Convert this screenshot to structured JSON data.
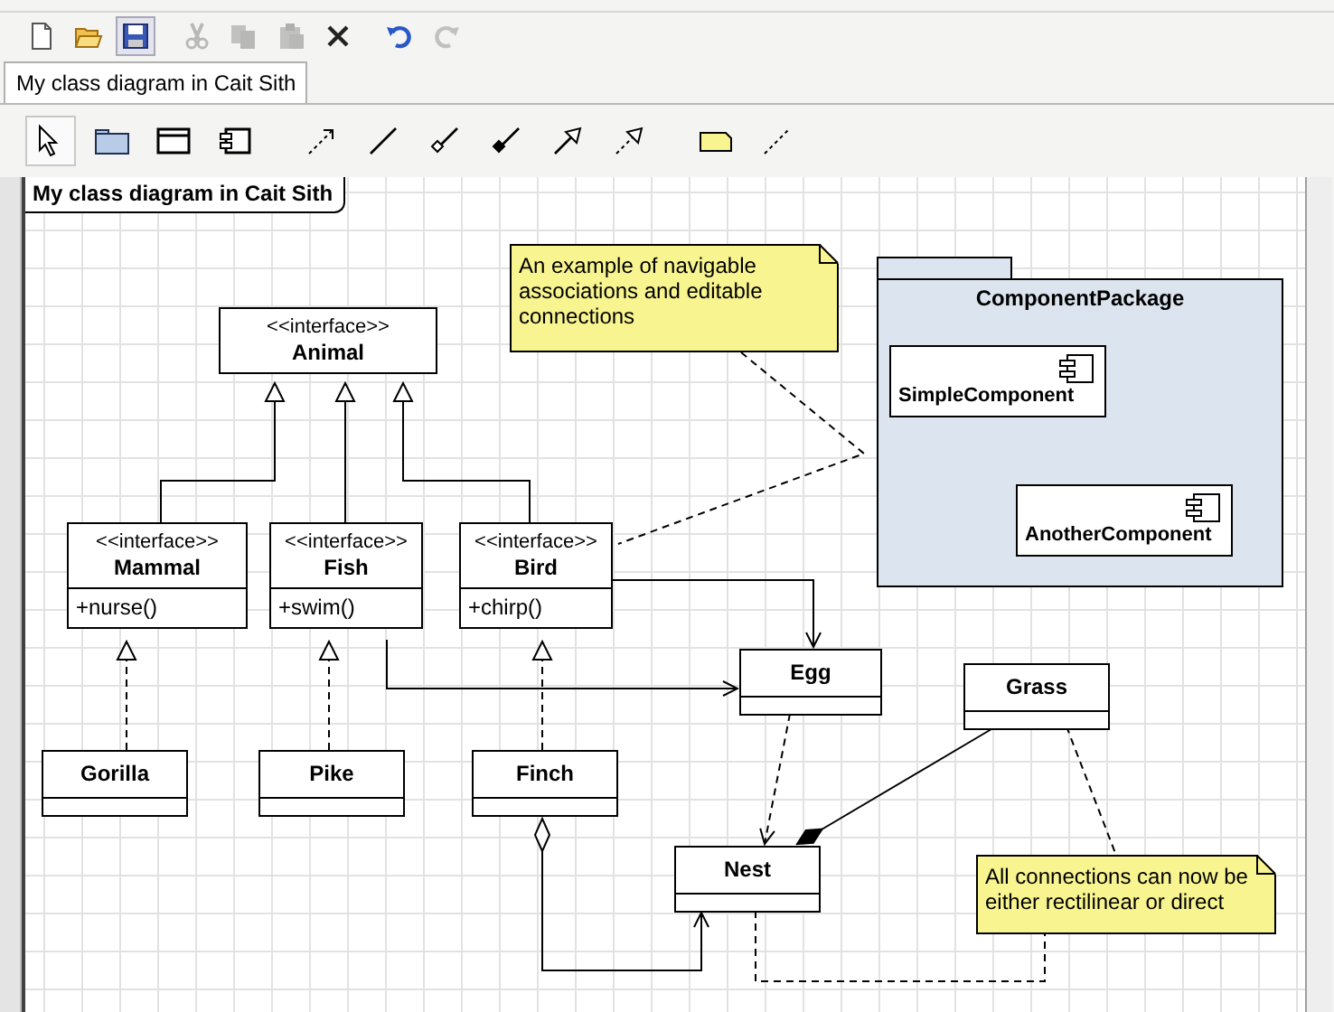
{
  "toolbar": [
    {
      "kind": "new",
      "disabled": false,
      "selected": false
    },
    {
      "kind": "open",
      "disabled": false,
      "selected": false
    },
    {
      "kind": "save",
      "disabled": false,
      "selected": true
    },
    {
      "kind": "cut",
      "disabled": true,
      "selected": false
    },
    {
      "kind": "copy",
      "disabled": true,
      "selected": false
    },
    {
      "kind": "paste",
      "disabled": true,
      "selected": false
    },
    {
      "kind": "delete",
      "disabled": false,
      "selected": false
    },
    {
      "kind": "undo",
      "disabled": false,
      "selected": false
    },
    {
      "kind": "redo",
      "disabled": true,
      "selected": false
    }
  ],
  "tabs": [
    {
      "label": "My class diagram in Cait Sith",
      "selected": true
    }
  ],
  "palette": [
    {
      "kind": "select",
      "selected": true
    },
    {
      "kind": "package",
      "selected": false
    },
    {
      "kind": "class",
      "selected": false
    },
    {
      "kind": "component",
      "selected": false
    },
    {
      "kind": "dependency",
      "selected": false
    },
    {
      "kind": "association",
      "selected": false
    },
    {
      "kind": "aggregation",
      "selected": false
    },
    {
      "kind": "composition",
      "selected": false
    },
    {
      "kind": "generalization",
      "selected": false
    },
    {
      "kind": "realization",
      "selected": false
    },
    {
      "kind": "note",
      "selected": false
    },
    {
      "kind": "note-link",
      "selected": false
    }
  ],
  "diagram": {
    "title": "My class diagram in Cait Sith",
    "classes": [
      {
        "kind": "interface",
        "stereotype": "<<interface>>",
        "name": "Animal"
      },
      {
        "kind": "interface",
        "stereotype": "<<interface>>",
        "name": "Mammal",
        "operations": [
          "+nurse()"
        ]
      },
      {
        "kind": "interface",
        "stereotype": "<<interface>>",
        "name": "Fish",
        "operations": [
          "+swim()"
        ]
      },
      {
        "kind": "interface",
        "stereotype": "<<interface>>",
        "name": "Bird",
        "operations": [
          "+chirp()"
        ]
      },
      {
        "kind": "class",
        "name": "Egg"
      },
      {
        "kind": "class",
        "name": "Grass"
      },
      {
        "kind": "class",
        "name": "Gorilla"
      },
      {
        "kind": "class",
        "name": "Pike"
      },
      {
        "kind": "class",
        "name": "Finch"
      },
      {
        "kind": "class",
        "name": "Nest"
      }
    ],
    "notes": [
      {
        "text": "An example of navigable associations and editable connections"
      },
      {
        "text": "All connections can now be either rectilinear or direct"
      }
    ],
    "package": {
      "name": "ComponentPackage",
      "components": [
        {
          "name": "SimpleComponent"
        },
        {
          "name": "AnotherComponent"
        }
      ]
    }
  }
}
